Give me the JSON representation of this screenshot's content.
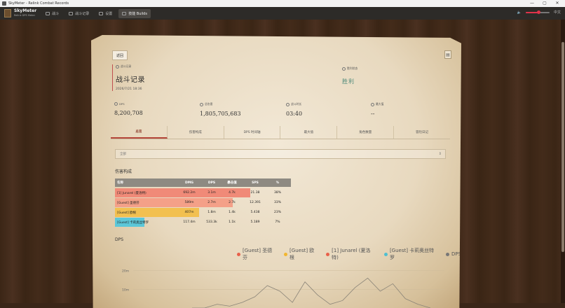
{
  "window": {
    "title": "SkyMeter - Relink Combat Records",
    "min": "—",
    "max": "▢",
    "close": "✕"
  },
  "app": {
    "brand": "SkyMeter",
    "sub": "Relink DPS Meter",
    "locale": "中文"
  },
  "nav": [
    {
      "label": "战斗"
    },
    {
      "label": "战斗记录"
    },
    {
      "label": "设置"
    },
    {
      "label": "技能 Builds"
    }
  ],
  "volume": {
    "level": 0.55
  },
  "paper": {
    "back": "返回",
    "battle_label": "战斗记录",
    "title": "战斗记录",
    "date": "2026/7/21 18:36",
    "result_label": "胜利状态",
    "result": "胜利",
    "stats": [
      {
        "label": "DPS",
        "value": "8,200,708"
      },
      {
        "label": "总伤害",
        "value": "1,805,705,683"
      },
      {
        "label": "战斗时长",
        "value": "03:40"
      },
      {
        "label": "最大值",
        "value": "--"
      }
    ],
    "tabs": [
      "总览",
      "伤害构成",
      "DPS 时间轴",
      "最大值",
      "角色数量",
      "冒险日记"
    ],
    "filter": "全部",
    "breakdown_title": "伤害构成",
    "columns": [
      "名称",
      "DMG",
      "DPS",
      "暴击值",
      "SPS",
      "%"
    ],
    "rows": [
      {
        "name": "[1] Junarel (夏洛特)",
        "dmg": "692.2m",
        "dps": "3.1m",
        "crit": "4.7k",
        "sps": "21.38",
        "pct": "38%",
        "share": 0.38,
        "color": "#f08a78"
      },
      {
        "name": "[Guest] 圣德芬",
        "dmg": "589m",
        "dps": "2.7m",
        "crit": "2.7k",
        "sps": "12.391",
        "pct": "33%",
        "share": 0.33,
        "color": "#f4a088"
      },
      {
        "name": "[Guest] 欧根",
        "dmg": "407m",
        "dps": "1.8m",
        "crit": "1.4k",
        "sps": "5.438",
        "pct": "23%",
        "share": 0.23,
        "color": "#f2c050"
      },
      {
        "name": "[Guest] 卡莉奥丝特罗",
        "dmg": "117.4m",
        "dps": "533.3k",
        "crit": "1.1k",
        "sps": "5.189",
        "pct": "7%",
        "share": 0.07,
        "color": "#5cc7d8"
      }
    ],
    "dps_title": "DPS"
  },
  "chart_data": {
    "type": "line",
    "ylabel": "",
    "yticks": [
      "20m",
      "10m"
    ],
    "legend": [
      {
        "name": "[Guest] 圣德芬",
        "color": "#e8604a"
      },
      {
        "name": "[Guest] 欧根",
        "color": "#f2b630"
      },
      {
        "name": "[1] Junarel (夏洛特)",
        "color": "#e8604a"
      },
      {
        "name": "[Guest] 卡莉奥丝特罗",
        "color": "#4fbfd0"
      },
      {
        "name": "DPS",
        "color": "#777777"
      }
    ],
    "series": [
      {
        "values": [
          0,
          0,
          2,
          1,
          3,
          6,
          12,
          9,
          3,
          14,
          7,
          2,
          4,
          11,
          16,
          9,
          13,
          5,
          2,
          0
        ]
      }
    ]
  }
}
